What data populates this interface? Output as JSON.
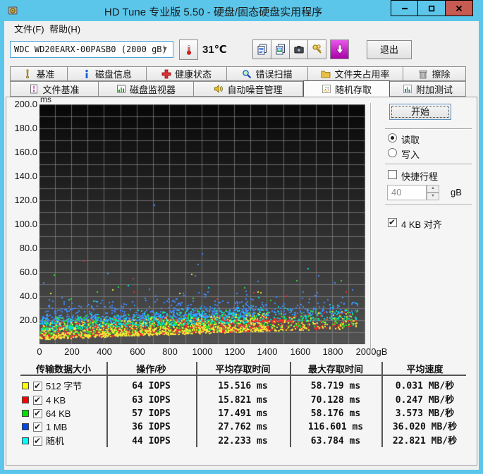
{
  "window": {
    "title": "HD Tune 专业版 5.50 - 硬盘/固态硬盘实用程序"
  },
  "menu": {
    "items": [
      "文件(F)",
      "帮助(H)"
    ]
  },
  "toolbar": {
    "drive_select_value": "WDC WD20EARX-00PASB0 (2000 gB)",
    "temperature": "31℃",
    "exit_label": "退出"
  },
  "tabs": {
    "row1": [
      {
        "label": "基准"
      },
      {
        "label": "磁盘信息"
      },
      {
        "label": "健康状态"
      },
      {
        "label": "错误扫描"
      },
      {
        "label": "文件夹占用率"
      },
      {
        "label": "擦除"
      }
    ],
    "row2": [
      {
        "label": "文件基准"
      },
      {
        "label": "磁盘监视器"
      },
      {
        "label": "自动噪音管理"
      },
      {
        "label": "随机存取"
      },
      {
        "label": "附加测试"
      }
    ],
    "active_tab": "随机存取"
  },
  "controls": {
    "start_label": "开始",
    "read_label": "读取",
    "write_label": "写入",
    "read_selected": true,
    "write_selected": false,
    "short_stroke_label": "快捷行程",
    "short_stroke_checked": false,
    "short_stroke_value": "40",
    "short_stroke_unit": "gB",
    "align_label": "4 KB 对齐",
    "align_checked": true
  },
  "results_table": {
    "headers": [
      "传输数据大小",
      "操作/秒",
      "平均存取时间",
      "最大存取时间",
      "平均速度"
    ],
    "rows": [
      {
        "swatch": "#ffff00",
        "checked": true,
        "label": "512 字节",
        "ops": "64 IOPS",
        "avg": "15.516 ms",
        "max": "58.719 ms",
        "speed": "0.031 MB/秒"
      },
      {
        "swatch": "#ff0000",
        "checked": true,
        "label": "4 KB",
        "ops": "63 IOPS",
        "avg": "15.821 ms",
        "max": "70.128 ms",
        "speed": "0.247 MB/秒"
      },
      {
        "swatch": "#00e000",
        "checked": true,
        "label": "64 KB",
        "ops": "57 IOPS",
        "avg": "17.491 ms",
        "max": "58.176 ms",
        "speed": "3.573 MB/秒"
      },
      {
        "swatch": "#0048e0",
        "checked": true,
        "label": "1 MB",
        "ops": "36 IOPS",
        "avg": "27.762 ms",
        "max": "116.601 ms",
        "speed": "36.020 MB/秒"
      },
      {
        "swatch": "#00ffff",
        "checked": true,
        "label": "随机",
        "ops": "44 IOPS",
        "avg": "22.233 ms",
        "max": "63.784 ms",
        "speed": "22.821 MB/秒"
      }
    ]
  },
  "chart_data": {
    "type": "scatter",
    "title": "随机存取 access time vs. disk position",
    "xlabel": "gB",
    "ylabel": "ms",
    "xlim": [
      0,
      2000
    ],
    "ylim": [
      0,
      200
    ],
    "x_tick_labels": [
      "0",
      "200",
      "400",
      "600",
      "800",
      "1000",
      "1200",
      "1400",
      "1600",
      "1800",
      "2000gB"
    ],
    "y_tick_labels": [
      "200.0",
      "180.0",
      "160.0",
      "140.0",
      "120.0",
      "100.0",
      "80.0",
      "60.0",
      "40.0",
      "20.0"
    ],
    "grid": {
      "x_step_gb": 100,
      "y_step_ms": 10
    },
    "background_top": "#070707",
    "background_bottom": "#525252",
    "grid_color": "#8f8f8f",
    "data_x_extent_gb": 1950,
    "density_falloff_gb": 1400,
    "min_envelope": {
      "base_ms": 3.5,
      "rise_ms": 10,
      "power": 0.8
    },
    "series": [
      {
        "name": "1 MB",
        "color": "#3f8cff",
        "count": 850,
        "offset_ms": 13,
        "jitter_ms": 5,
        "cap_ms": 22,
        "avg_ms": 27.762,
        "max_ms": 116.601,
        "outliers": {
          "count": 10,
          "min_ms": 42,
          "max_ms": 78
        },
        "max_point": {
          "gb": 700,
          "ms": 116.601
        }
      },
      {
        "name": "随机",
        "color": "#00e0e0",
        "count": 850,
        "offset_ms": 8,
        "jitter_ms": 3.5,
        "cap_ms": 14,
        "avg_ms": 22.233,
        "max_ms": 63.784,
        "outliers": {
          "count": 6,
          "min_ms": 34,
          "max_ms": 55
        },
        "max_point": {
          "gb": 1645,
          "ms": 63.784
        }
      },
      {
        "name": "64 KB",
        "color": "#2ce02c",
        "count": 900,
        "offset_ms": 2,
        "jitter_ms": 6,
        "cap_ms": 17,
        "avg_ms": 17.491,
        "max_ms": 58.176,
        "outliers": {
          "count": 8,
          "min_ms": 34,
          "max_ms": 56
        },
        "max_point": {
          "gb": 85,
          "ms": 58.176
        }
      },
      {
        "name": "4 KB",
        "color": "#f03030",
        "count": 900,
        "offset_ms": 0.8,
        "jitter_ms": 5,
        "cap_ms": 15,
        "avg_ms": 15.821,
        "max_ms": 70.128,
        "outliers": {
          "count": 6,
          "min_ms": 34,
          "max_ms": 60
        },
        "streak": {
          "gb_min": 1280,
          "gb_max": 1560,
          "ms": 19.8,
          "spread_ms": 0.8,
          "count": 90
        },
        "max_point": {
          "gb": 270,
          "ms": 70.128
        }
      },
      {
        "name": "512 字节",
        "color": "#f0e838",
        "count": 900,
        "offset_ms": 0.2,
        "jitter_ms": 5,
        "cap_ms": 15,
        "avg_ms": 15.516,
        "max_ms": 58.719,
        "outliers": {
          "count": 5,
          "min_ms": 34,
          "max_ms": 55
        },
        "max_point": {
          "gb": 930,
          "ms": 58.719
        }
      }
    ]
  }
}
